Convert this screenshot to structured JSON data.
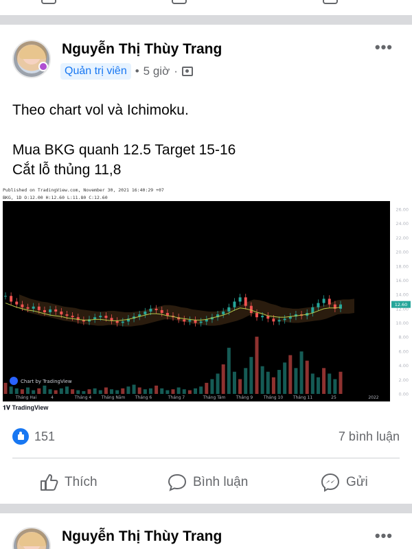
{
  "post": {
    "author": "Nguyễn Thị Thùy Trang",
    "role": "Quản trị viên",
    "time": "5 giờ",
    "text": "Theo chart vol và Ichimoku.\n\nMua BKG quanh 12.5 Target 15-16\nCắt lỗ thủng 11,8",
    "more_icon": "more-dots-icon",
    "audience_icon": "group-icon"
  },
  "chart_image": {
    "published": "Published on TradingView.com, November 30, 2021 16:40:29 +07",
    "symbol_line": "BKG, 1D O:12.00 H:12.60 L:11.80 C:12.60",
    "watermark": "Chart by TradingView",
    "brand": "TradingView",
    "price_label": "12.60"
  },
  "chart_data": {
    "type": "line",
    "title": "",
    "y_ticks": [
      "26.00",
      "24.00",
      "22.00",
      "20.00",
      "18.00",
      "16.00",
      "14.00",
      "12.00",
      "10.00",
      "8.00",
      "6.00",
      "4.00",
      "2.00",
      "0.00"
    ],
    "x_ticks": [
      "Tháng Hai",
      "4",
      "Tháng 4",
      "Tháng Năm",
      "Tháng 6",
      "Tháng 7",
      "Tháng Tám",
      "Tháng 9",
      "Tháng 10",
      "Tháng 11",
      "25",
      "2022"
    ],
    "ylim": [
      0,
      26
    ],
    "background": "#000000",
    "series": [
      {
        "values": [
          13.8,
          13.0,
          12.6,
          12.2,
          12.0,
          12.3,
          11.8,
          11.5,
          11.9,
          11.6,
          11.2,
          11.0,
          10.8,
          10.4,
          10.2,
          10.5,
          10.8,
          11.0,
          10.7,
          10.3,
          10.0,
          10.2,
          10.6,
          10.9,
          11.2,
          11.6,
          12.0,
          11.8,
          11.4,
          11.0,
          10.8,
          10.5,
          10.2,
          10.4,
          10.0,
          10.2,
          10.5,
          10.8,
          11.2,
          11.6,
          12.2,
          13.0,
          13.6,
          12.4,
          11.4,
          10.8,
          11.0,
          10.6,
          10.2,
          10.4,
          10.6,
          10.9,
          11.2,
          11.0,
          11.4,
          12.2,
          12.8,
          13.4,
          12.6,
          12.0,
          12.6
        ]
      },
      {
        "values": [
          12.8,
          12.5,
          12.2,
          12.0,
          11.8,
          11.7,
          11.5,
          11.3,
          11.1,
          11.0,
          10.9,
          10.7,
          10.6,
          10.5,
          10.4,
          10.4,
          10.5,
          10.5,
          10.4,
          10.3,
          10.3,
          10.4,
          10.5,
          10.7,
          10.9,
          11.1,
          11.3,
          11.3,
          11.2,
          11.0,
          10.9,
          10.7,
          10.6,
          10.5,
          10.4,
          10.4,
          10.5,
          10.7,
          10.9,
          11.1,
          11.4,
          11.8,
          12.1,
          12.0,
          11.8,
          11.5,
          11.3,
          11.0,
          10.9,
          10.8,
          10.8,
          10.9,
          11.0,
          11.1,
          11.2,
          11.4,
          11.7,
          12.0,
          12.1,
          12.1,
          12.2
        ]
      }
    ],
    "volume": [
      1.2,
      0.8,
      0.6,
      0.5,
      0.7,
      0.4,
      0.6,
      0.9,
      0.5,
      0.4,
      0.6,
      0.8,
      0.5,
      0.4,
      0.3,
      0.5,
      0.6,
      0.4,
      0.7,
      0.5,
      0.4,
      0.6,
      0.8,
      1.0,
      0.7,
      0.5,
      0.6,
      0.9,
      0.6,
      0.4,
      0.5,
      0.7,
      0.5,
      0.4,
      0.6,
      0.8,
      1.2,
      1.6,
      2.2,
      3.2,
      5.0,
      2.4,
      1.6,
      2.8,
      4.0,
      6.2,
      3.0,
      2.4,
      1.8,
      2.6,
      3.4,
      4.2,
      2.8,
      4.6,
      3.6,
      2.2,
      1.8,
      2.8,
      2.2,
      1.6,
      2.4
    ]
  },
  "reactions": {
    "count": "151",
    "comments": "7 bình luận"
  },
  "actions": {
    "like": "Thích",
    "comment": "Bình luận",
    "share": "Gửi"
  },
  "next_post": {
    "author": "Nguyễn Thị Thùy Trang"
  }
}
